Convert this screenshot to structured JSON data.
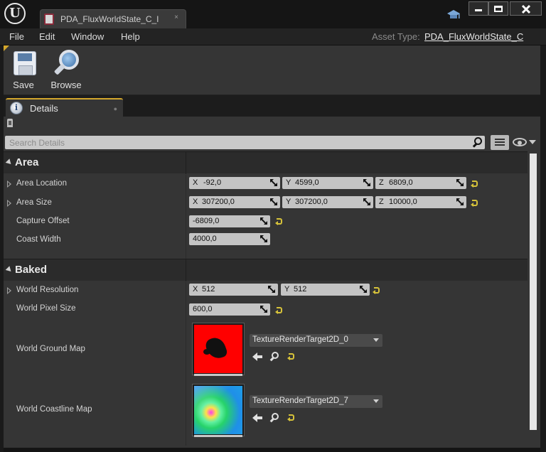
{
  "window": {
    "logo": "U",
    "tab_title": "PDA_FluxWorldState_C_I",
    "tab_close": "×"
  },
  "menu": {
    "items": [
      "File",
      "Edit",
      "Window",
      "Help"
    ],
    "asset_type_label": "Asset Type:",
    "asset_type_value": "PDA_FluxWorldState_C"
  },
  "toolbar": {
    "save_label": "Save",
    "browse_label": "Browse"
  },
  "details_tab": {
    "label": "Details",
    "info_glyph": "i"
  },
  "search": {
    "placeholder": "Search Details"
  },
  "categories": {
    "area": {
      "title": "Area",
      "area_location": {
        "label": "Area Location",
        "x_axis": "X",
        "x": "-92,0",
        "y_axis": "Y",
        "y": "4599,0",
        "z_axis": "Z",
        "z": "6809,0"
      },
      "area_size": {
        "label": "Area Size",
        "x_axis": "X",
        "x": "307200,0",
        "y_axis": "Y",
        "y": "307200,0",
        "z_axis": "Z",
        "z": "10000,0"
      },
      "capture_offset": {
        "label": "Capture Offset",
        "value": "-6809,0"
      },
      "coast_width": {
        "label": "Coast Width",
        "value": "4000,0"
      }
    },
    "baked": {
      "title": "Baked",
      "world_resolution": {
        "label": "World Resolution",
        "x_axis": "X",
        "x": "512",
        "y_axis": "Y",
        "y": "512"
      },
      "world_pixel_size": {
        "label": "World Pixel Size",
        "value": "600,0"
      },
      "world_ground_map": {
        "label": "World Ground Map",
        "asset": "TextureRenderTarget2D_0"
      },
      "world_coastline_map": {
        "label": "World Coastline Map",
        "asset": "TextureRenderTarget2D_7"
      }
    }
  },
  "colors": {
    "accent": "#d4a72c",
    "reset_arrow": "#d6c23a",
    "ground_map_fill": "#ff0000"
  },
  "icons": [
    "unreal-logo-icon",
    "blueprint-asset-icon",
    "graduation-cap-icon",
    "save-icon",
    "browse-icon",
    "info-icon",
    "lock-icon",
    "search-icon",
    "view-options-icon",
    "eye-icon",
    "reset-to-default-icon",
    "drag-arrows-icon",
    "use-selected-arrow-icon"
  ]
}
